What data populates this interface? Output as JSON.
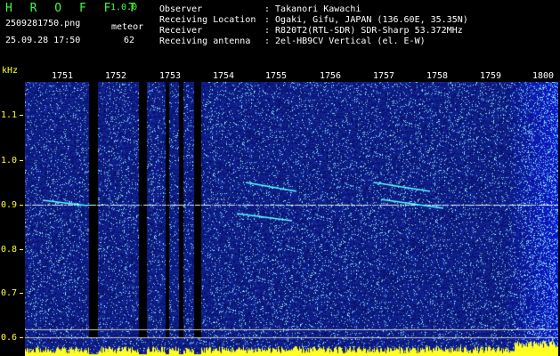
{
  "header": {
    "brand": "H R O F F T",
    "version": "1.0.0",
    "filename": "2509281750.png",
    "counter_label": "meteor",
    "timestamp": "25.09.28 17:50",
    "counter_value": "62"
  },
  "station": {
    "observer_label": "Observer",
    "observer_value": ": Takanori Kawachi",
    "location_label": "Receiving Location",
    "location_value": ": Ogaki, Gifu, JAPAN (136.60E, 35.35N)",
    "receiver_label": "Receiver",
    "receiver_value": ": R820T2(RTL-SDR) SDR-Sharp 53.372MHz",
    "antenna_label": "Receiving antenna",
    "antenna_value": ": 2el-HB9CV Vertical (el. E-W)"
  },
  "axis": {
    "unit": "kHz",
    "y_ticks": [
      "1.1",
      "1.0",
      "0.9",
      "0.8",
      "0.7",
      "0.6"
    ],
    "x_ticks": [
      "1751",
      "1752",
      "1753",
      "1754",
      "1755",
      "1756",
      "1757",
      "1758",
      "1759",
      "1800"
    ]
  },
  "colors": {
    "background": "#000000",
    "spectrogram_bg": "#0a1680",
    "brand_text": "#3cff3c",
    "tick_text": "#ffff33",
    "signal": "#ffffff",
    "meteor_trail": "#55ffff"
  }
}
